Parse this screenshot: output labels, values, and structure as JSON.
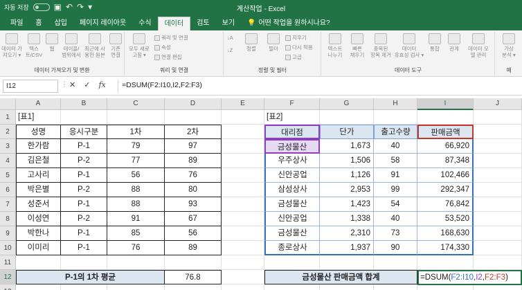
{
  "titlebar": {
    "autosave": "자동 저장",
    "toggle": "끔",
    "title": "계산작업 - Excel"
  },
  "tabs": [
    {
      "label": "파일",
      "active": false
    },
    {
      "label": "홈",
      "active": false
    },
    {
      "label": "삽입",
      "active": false
    },
    {
      "label": "페이지 레이아웃",
      "active": false
    },
    {
      "label": "수식",
      "active": false
    },
    {
      "label": "데이터",
      "active": true
    },
    {
      "label": "검토",
      "active": false
    },
    {
      "label": "보기",
      "active": false
    }
  ],
  "tellme": "어떤 작업을 원하시나요?",
  "ribbon": {
    "groups": [
      {
        "label": "데이터 가져오기 및 변환"
      },
      {
        "label": "쿼리 및 연결"
      },
      {
        "label": "정렬 및 필터"
      },
      {
        "label": "데이터 도구"
      },
      {
        "label": "예"
      }
    ],
    "buttons": {
      "get_data": "데이터 가\n져오기 ▾",
      "text_csv": "텍스\n트/CSV",
      "web": "웹",
      "table_range": "테이블/\n범위에서",
      "recent": "최근에 사\n용한 원본",
      "existing": "기존\n연결",
      "refresh_all": "모두 새로\n고침 ▾",
      "sort": "정렬",
      "filter": "필터",
      "text_to_columns": "텍스트\n나누기",
      "flash_fill": "빠른\n채우기",
      "remove_dup": "중복된\n항목 제거",
      "validation": "데이터\n유효성 검사 ▾",
      "consolidate": "통합",
      "relationships": "관계",
      "data_model": "데이터 모\n델 관리",
      "whatif": "가상\n분석 ▾"
    },
    "small": {
      "queries": "쿼리 및 연결",
      "properties": "속성",
      "edit_links": "연결 편집",
      "clear": "지우기",
      "reapply": "다시 적용",
      "advanced": "고급"
    }
  },
  "formula_bar": {
    "name_box": "I12",
    "cancel": "✕",
    "enter": "✓",
    "fx": "fx",
    "formula": "=DSUM(F2:I10,I2,F2:F3)"
  },
  "columns": [
    "A",
    "B",
    "C",
    "D",
    "E",
    "F",
    "G",
    "H",
    "I",
    "J"
  ],
  "rows": [
    "1",
    "2",
    "3",
    "4",
    "5",
    "6",
    "7",
    "8",
    "9",
    "10",
    "11",
    "12",
    "13"
  ],
  "table1": {
    "label": "[표1]",
    "headers": [
      "성명",
      "응시구분",
      "1차",
      "2차"
    ],
    "rows": [
      [
        "한가람",
        "P-1",
        "79",
        "97"
      ],
      [
        "김은철",
        "P-2",
        "77",
        "89"
      ],
      [
        "고사리",
        "P-1",
        "56",
        "76"
      ],
      [
        "박은별",
        "P-2",
        "88",
        "80"
      ],
      [
        "성준서",
        "P-1",
        "88",
        "93"
      ],
      [
        "이성연",
        "P-2",
        "91",
        "67"
      ],
      [
        "박한나",
        "P-1",
        "85",
        "56"
      ],
      [
        "이미리",
        "P-1",
        "76",
        "89"
      ]
    ],
    "result_label": "P-1의 1차 평균",
    "result_value": "76.8"
  },
  "table2": {
    "label": "[표2]",
    "headers": [
      "대리점",
      "단가",
      "출고수량",
      "판매금액"
    ],
    "rows": [
      [
        "금성물산",
        "1,673",
        "40",
        "66,920"
      ],
      [
        "우주상사",
        "1,506",
        "58",
        "87,348"
      ],
      [
        "신안공업",
        "1,126",
        "91",
        "102,466"
      ],
      [
        "삼성상사",
        "2,953",
        "99",
        "292,347"
      ],
      [
        "금성물산",
        "1,423",
        "54",
        "76,842"
      ],
      [
        "신안공업",
        "1,338",
        "40",
        "53,520"
      ],
      [
        "금성물산",
        "2,310",
        "73",
        "168,630"
      ],
      [
        "종로상사",
        "1,937",
        "90",
        "174,330"
      ]
    ],
    "result_label": "금성물산 판매금액 합계",
    "formula_parts": [
      "=DSUM(",
      "F2:I10",
      ",",
      "I2",
      ",",
      "F2:F3",
      ")"
    ]
  },
  "colors": {
    "excel_green": "#217346",
    "header_fill": "#dce6f1",
    "ref_blue": "#2f6fc4",
    "ref_purple": "#8e3fbf",
    "ref_red": "#c0392b"
  }
}
